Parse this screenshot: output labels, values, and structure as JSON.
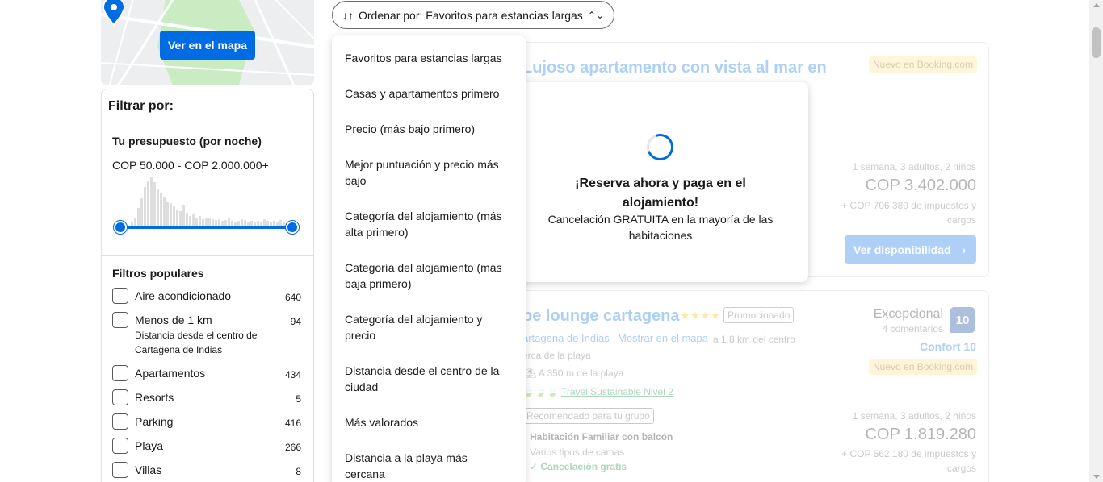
{
  "map": {
    "button_label": "Ver en el mapa",
    "pin_icon": "map-pin-icon"
  },
  "filters": {
    "title": "Filtrar por:",
    "budget": {
      "heading": "Tu presupuesto (por noche)",
      "range": "COP 50.000 - COP 2.000.000+"
    },
    "popular": {
      "heading": "Filtros populares",
      "items": [
        {
          "label": "Aire acondicionado",
          "count": "640"
        },
        {
          "label": "Menos de 1 km",
          "sub": "Distancia desde el centro de Cartagena de Indias",
          "count": "94"
        },
        {
          "label": "Apartamentos",
          "count": "434"
        },
        {
          "label": "Resorts",
          "count": "5"
        },
        {
          "label": "Parking",
          "count": "416"
        },
        {
          "label": "Playa",
          "count": "266"
        },
        {
          "label": "Villas",
          "count": "8"
        }
      ]
    }
  },
  "sort": {
    "label": "Ordenar por: Favoritos para estancias largas",
    "options": [
      "Favoritos para estancias largas",
      "Casas y apartamentos primero",
      "Precio (más bajo primero)",
      "Mejor puntuación y precio más bajo",
      "Categoría del alojamiento (más alta primero)",
      "Categoría del alojamiento (más baja primero)",
      "Categoría del alojamiento y precio",
      "Distancia desde el centro de la ciudad",
      "Más valorados",
      "Distancia a la playa más cercana"
    ]
  },
  "modal": {
    "title": "¡Reserva ahora y paga en el alojamiento!",
    "text": "Cancelación GRATUITA en la mayoría de las habitaciones"
  },
  "listing1": {
    "title": "Lujoso apartamento con vista al mar en",
    "badge": "Nuevo en Booking.com",
    "stay": "1 semana, 3 adultos, 2 niños",
    "price": "COP 3.402.000",
    "taxes": "+ COP 706.380 de impuestos y cargos",
    "button": "Ver disponibilidad"
  },
  "listing2": {
    "title": "be lounge cartagena",
    "stars": "★★★★",
    "promo": "Promocionado",
    "location_link": "artagena de Indias",
    "map_link": "Mostrar en el mapa",
    "distance": "a 1,8 km del centro",
    "beach": "erca de la playa",
    "beach_dist": "A 350 m de la playa",
    "sustainable": "Travel Sustainable Nivel 2",
    "recommended": "Recomendado para tu grupo",
    "room": "Habitación Familiar con balcón",
    "beds": "Varios tipos de camas",
    "cancel": "Cancelación gratis",
    "score_word": "Excepcional",
    "reviews": "4 comentarios",
    "score": "10",
    "comfort": "Confort 10",
    "badge": "Nuevo en Booking.com",
    "stay": "1 semana, 3 adultos, 2 niños",
    "price": "COP 1.819.280",
    "taxes": "+ COP 662.180 de impuestos y cargos"
  }
}
